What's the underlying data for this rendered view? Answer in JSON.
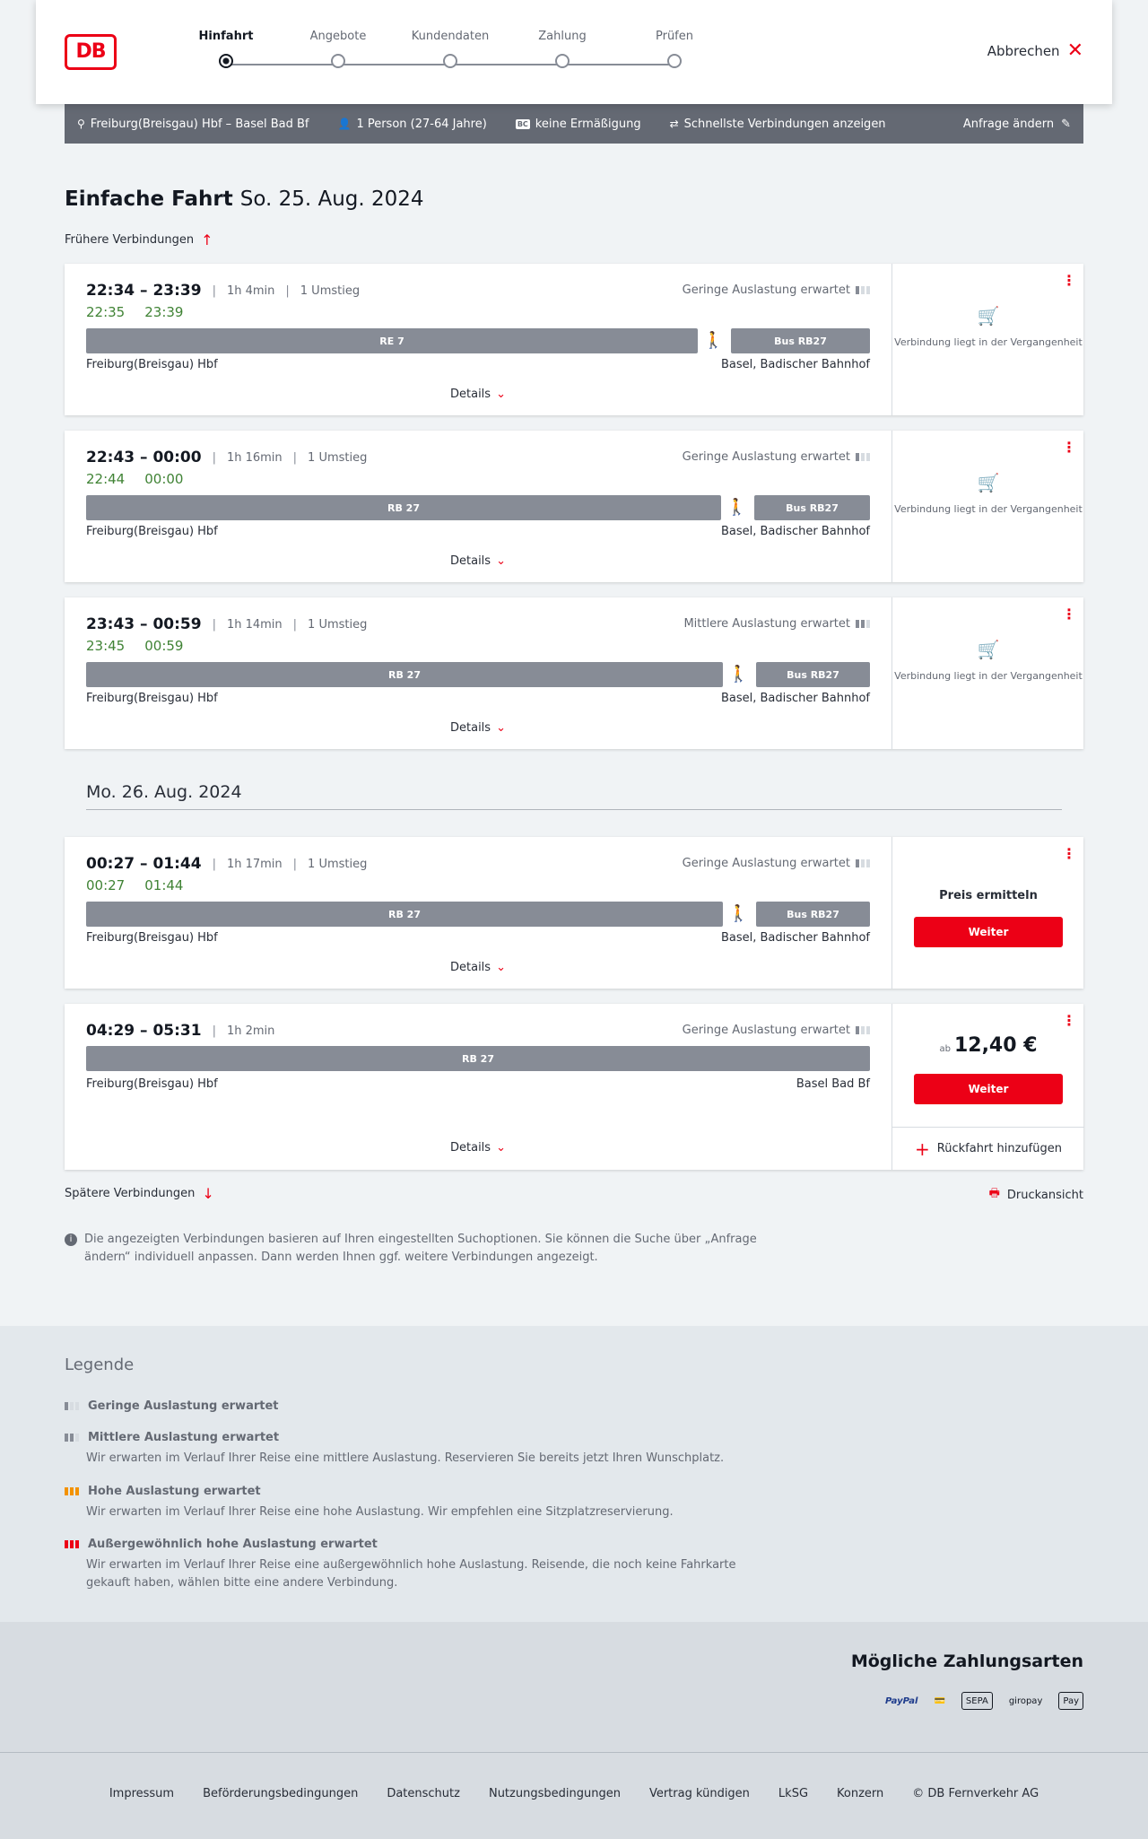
{
  "header": {
    "logo": "DB",
    "steps": [
      "Hinfahrt",
      "Angebote",
      "Kundendaten",
      "Zahlung",
      "Prüfen"
    ],
    "active_step": 0,
    "abort_label": "Abbrechen"
  },
  "infobar": {
    "route": "Freiburg(Breisgau) Hbf – Basel Bad Bf",
    "passengers": "1 Person (27-64 Jahre)",
    "discount_badge": "BC",
    "discount": "keine Ermäßigung",
    "fastest": "Schnellste Verbindungen anzeigen",
    "change": "Anfrage ändern"
  },
  "page": {
    "title": "Einfache Fahrt",
    "date": "So. 25. Aug. 2024",
    "earlier": "Frühere Verbindungen",
    "later": "Spätere Verbindungen",
    "next_day": "Mo. 26. Aug. 2024",
    "print": "Druckansicht",
    "note": "Die angezeigten Verbindungen basieren auf Ihren eingestellten Suchoptionen. Sie können die Suche über „Anfrage ändern“ individuell anpassen. Dann werden Ihnen ggf. weitere Verbindungen angezeigt."
  },
  "connections": [
    {
      "times": "22:34 – 23:39",
      "duration": "1h 4min",
      "changes": "1 Umstieg",
      "rt_dep": "22:35",
      "rt_arr": "23:39",
      "load": "Geringe Auslastung erwartet",
      "seg1": "RE 7",
      "seg2": "Bus RB27",
      "from": "Freiburg(Breisgau) Hbf",
      "to": "Basel, Badischer Bahnhof",
      "details": "Details",
      "status": "Verbindung liegt in der Vergangenheit"
    },
    {
      "times": "22:43 – 00:00",
      "duration": "1h 16min",
      "changes": "1 Umstieg",
      "rt_dep": "22:44",
      "rt_arr": "00:00",
      "load": "Geringe Auslastung erwartet",
      "seg1": "RB 27",
      "seg2": "Bus RB27",
      "from": "Freiburg(Breisgau) Hbf",
      "to": "Basel, Badischer Bahnhof",
      "details": "Details",
      "status": "Verbindung liegt in der Vergangenheit"
    },
    {
      "times": "23:43 – 00:59",
      "duration": "1h 14min",
      "changes": "1 Umstieg",
      "rt_dep": "23:45",
      "rt_arr": "00:59",
      "load": "Mittlere Auslastung erwartet",
      "seg1": "RB 27",
      "seg2": "Bus RB27",
      "from": "Freiburg(Breisgau) Hbf",
      "to": "Basel, Badischer Bahnhof",
      "details": "Details",
      "status": "Verbindung liegt in der Vergangenheit"
    },
    {
      "times": "00:27 – 01:44",
      "duration": "1h 17min",
      "changes": "1 Umstieg",
      "rt_dep": "00:27",
      "rt_arr": "01:44",
      "load": "Geringe Auslastung erwartet",
      "seg1": "RB 27",
      "seg2": "Bus RB27",
      "from": "Freiburg(Breisgau) Hbf",
      "to": "Basel, Badischer Bahnhof",
      "details": "Details",
      "price_label": "Preis ermitteln",
      "button": "Weiter"
    },
    {
      "times": "04:29 – 05:31",
      "duration": "1h 2min",
      "load": "Geringe Auslastung erwartet",
      "seg1": "RB 27",
      "from": "Freiburg(Breisgau) Hbf",
      "to": "Basel Bad Bf",
      "details": "Details",
      "price_prefix": "ab",
      "price": "12,40 €",
      "button": "Weiter",
      "return": "Rückfahrt hinzufügen"
    }
  ],
  "legend": {
    "title": "Legende",
    "items": [
      {
        "title": "Geringe Auslastung erwartet",
        "desc": ""
      },
      {
        "title": "Mittlere Auslastung erwartet",
        "desc": "Wir erwarten im Verlauf Ihrer Reise eine mittlere Auslastung. Reservieren Sie bereits jetzt Ihren Wunschplatz."
      },
      {
        "title": "Hohe Auslastung erwartet",
        "desc": "Wir erwarten im Verlauf Ihrer Reise eine hohe Auslastung. Wir empfehlen eine Sitzplatzreservierung."
      },
      {
        "title": "Außergewöhnlich hohe Auslastung erwartet",
        "desc": "Wir erwarten im Verlauf Ihrer Reise eine außergewöhnlich hohe Auslastung. Reisende, die noch keine Fahrkarte gekauft haben, wählen bitte eine andere Verbindung."
      }
    ]
  },
  "payment": {
    "title": "Mögliche Zahlungsarten",
    "methods": [
      "PayPal",
      "Kreditkarte",
      "SEPA",
      "giropay",
      "Pay"
    ]
  },
  "footer": {
    "links": [
      "Impressum",
      "Beförderungsbedingungen",
      "Datenschutz",
      "Nutzungsbedingungen",
      "Vertrag kündigen",
      "LkSG",
      "Konzern"
    ],
    "copyright": "© DB Fernverkehr AG"
  },
  "colors": {
    "accent": "#ec0016",
    "realtime": "#408335",
    "segment": "#878c96",
    "infobar": "#646973"
  }
}
